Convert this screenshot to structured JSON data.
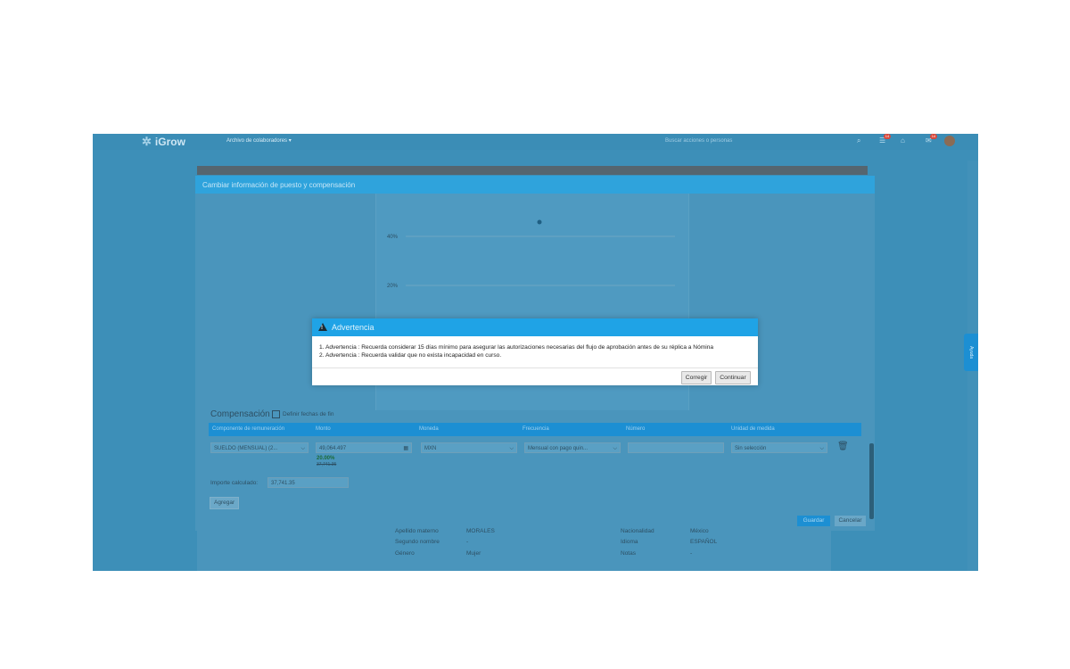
{
  "app": {
    "logo": "iGrow",
    "module": "Archivo de colaboradores",
    "search_placeholder": "Buscar acciones o personas",
    "notif_badge": "14",
    "msg_badge": "14",
    "side_tab": "Ayuda"
  },
  "dialog": {
    "title": "Cambiar información de puesto y compensación",
    "chart": {
      "y_ticks": [
        "40%",
        "20%"
      ]
    },
    "compensation": {
      "section_title": "Compensación",
      "end_date_label": "Definir fechas de fin",
      "columns": [
        "Componente de remuneración",
        "Monto",
        "Moneda",
        "Frecuencia",
        "Número",
        "Unidad de medida"
      ],
      "row": {
        "component": "SUELDO (MENSUAL) (2...",
        "amount": "49,064.497",
        "percent": "20.00%",
        "previous": "37,741.35",
        "currency": "MXN",
        "frequency": "Mensual con pago quin...",
        "number": "",
        "unit": "Sin selección"
      },
      "calc_label": "Importe calculado:",
      "calc_value": "37,741.35",
      "add_button": "Agregar"
    },
    "save_button": "Guardar",
    "cancel_button": "Cancelar"
  },
  "profile": {
    "r1": [
      "Apellido materno",
      "MORALES",
      "Nacionalidad",
      "México"
    ],
    "r2": [
      "Segundo nombre",
      "-",
      "Idioma",
      "ESPAÑOL"
    ],
    "r3": [
      "Género",
      "Mujer",
      "Notas",
      "-"
    ]
  },
  "modal": {
    "title": "Advertencia",
    "line1": "1. Advertencia : Recuerda considerar 15 días mínimo para asegurar las autorizaciones necesarias del flujo de aprobación antes de su réplica a Nómina",
    "line2": "2. Advertencia : Recuerda validar que no exista incapacidad en curso.",
    "correct_button": "Corregir",
    "continue_button": "Continuar"
  },
  "colors": {
    "backdrop": "#3d8fb8",
    "header_blue": "#1fa3e6",
    "table_header": "#1c8fd3"
  }
}
